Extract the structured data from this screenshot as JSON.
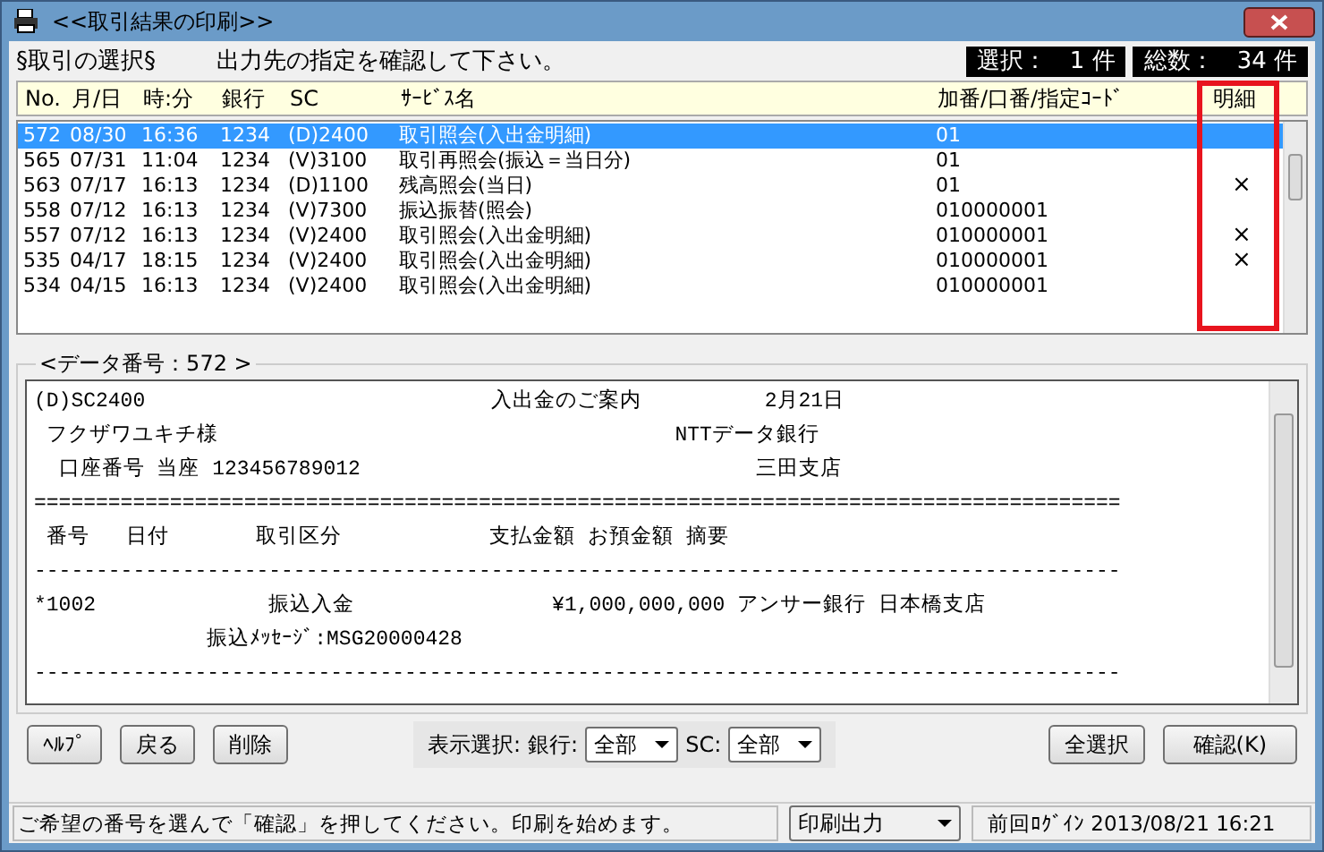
{
  "window": {
    "title": "<<取引結果の印刷>>"
  },
  "header": {
    "section": "§取引の選択§",
    "instruction": "出力先の指定を確認して下さい。",
    "selected_count": "選択：　1 件",
    "total_count": "総数：　34 件"
  },
  "table": {
    "columns": [
      {
        "label": "No."
      },
      {
        "label": "月/日"
      },
      {
        "label": "時:分"
      },
      {
        "label": "銀行"
      },
      {
        "label": "SC"
      },
      {
        "label": "ｻｰﾋﾞｽ名"
      },
      {
        "label": "加番/口番/指定ｺｰﾄﾞ"
      },
      {
        "label": "明細",
        "highlighted": true
      }
    ],
    "rows": [
      {
        "selected": true,
        "cells": [
          "572",
          "08/30",
          "16:36",
          "1234",
          "(D)2400",
          "取引照会(入出金明細)",
          "01"
        ]
      },
      {
        "selected": false,
        "cells": [
          "565",
          "07/31",
          "11:04",
          "1234",
          "(V)3100",
          "取引再照会(振込＝当日分)",
          "01"
        ]
      },
      {
        "selected": false,
        "cells": [
          "563",
          "07/17",
          "16:13",
          "1234",
          "(D)1100",
          "残高照会(当日)",
          "01"
        ],
        "mark": "×"
      },
      {
        "selected": false,
        "cells": [
          "558",
          "07/12",
          "16:13",
          "1234",
          "(V)7300",
          "振込振替(照会)",
          "010000001"
        ]
      },
      {
        "selected": false,
        "cells": [
          "557",
          "07/12",
          "16:13",
          "1234",
          "(V)2400",
          "取引照会(入出金明細)",
          "010000001"
        ],
        "mark": "×"
      },
      {
        "selected": false,
        "cells": [
          "535",
          "04/17",
          "18:15",
          "1234",
          "(V)2400",
          "取引照会(入出金明細)",
          "010000001"
        ],
        "mark": "×"
      },
      {
        "selected": false,
        "cells": [
          "534",
          "04/15",
          "16:13",
          "1234",
          "(V)2400",
          "取引照会(入出金明細)",
          "010000001"
        ]
      }
    ]
  },
  "preview": {
    "legend": "<データ番号：572 >",
    "lines": [
      "(D)SC2400                            入出金のご案内          2月21日",
      " フクザワユキチ様                                     NTTデータ銀行",
      "  口座番号 当座 123456789012                                三田支店",
      "========================================================================================",
      " 番号   日付       取引区分            支払金額 お預金額 摘要",
      "----------------------------------------------------------------------------------------",
      "*1002              振込入金                ¥1,000,000,000 アンサー銀行 日本橋支店",
      "              振込ﾒｯｾｰｼﾞ:MSG20000428",
      "----------------------------------------------------------------------------------------"
    ]
  },
  "buttons_left": [
    "ﾍﾙﾌﾟ",
    "戻る",
    "削除"
  ],
  "filter": {
    "label": "表示選択:",
    "bank_label": "銀行:",
    "bank_value": "全部",
    "sc_label": "SC:",
    "sc_value": "全部"
  },
  "buttons_right": [
    "全選択",
    "確認(K)"
  ],
  "status_bar": {
    "message": "ご希望の番号を選んで「確認」を押してください。印刷を始めます。",
    "output": "印刷出力",
    "last_login": "前回ﾛｸﾞｲﾝ 2013/08/21 16:21"
  }
}
